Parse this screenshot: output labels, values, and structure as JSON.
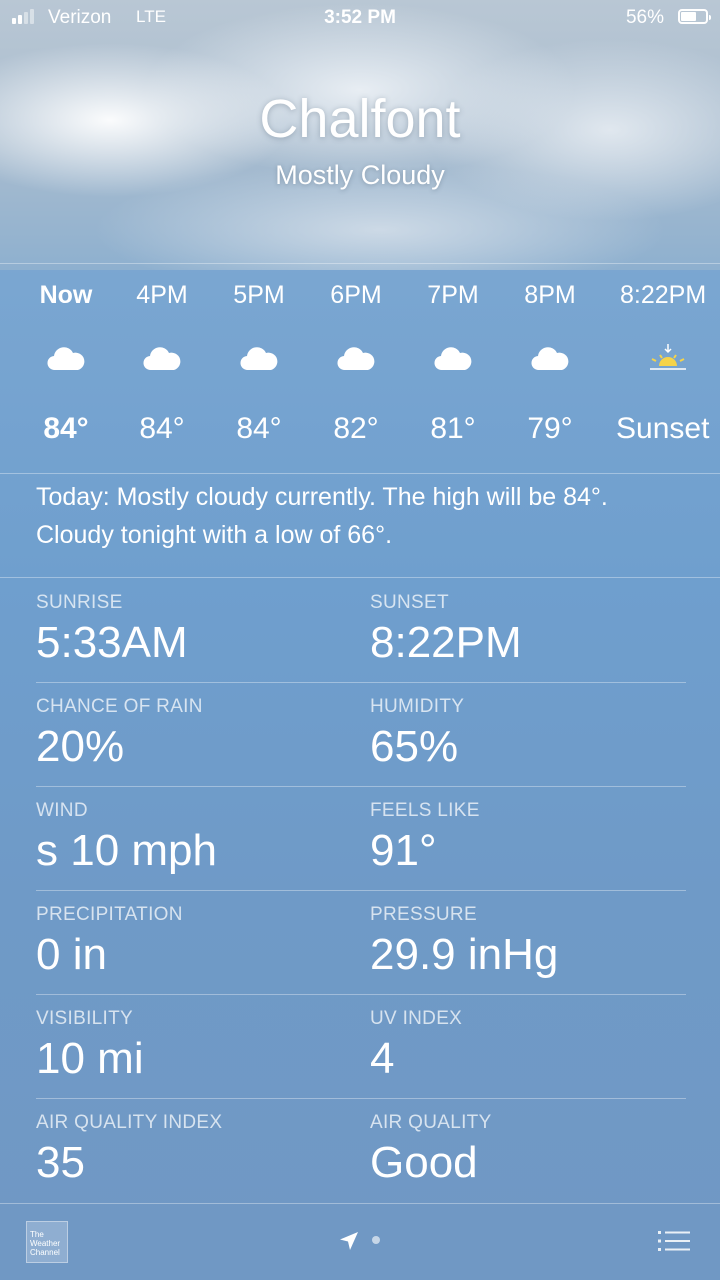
{
  "status_bar": {
    "carrier": "Verizon",
    "network": "LTE",
    "time": "3:52 PM",
    "battery": "56%"
  },
  "location": {
    "city": "Chalfont",
    "condition": "Mostly Cloudy"
  },
  "hourly": [
    {
      "time": "Now",
      "temp": "84°",
      "icon": "cloud-icon"
    },
    {
      "time": "4PM",
      "temp": "84°",
      "icon": "cloud-icon"
    },
    {
      "time": "5PM",
      "temp": "84°",
      "icon": "cloud-icon"
    },
    {
      "time": "6PM",
      "temp": "82°",
      "icon": "cloud-icon"
    },
    {
      "time": "7PM",
      "temp": "81°",
      "icon": "cloud-icon"
    },
    {
      "time": "8PM",
      "temp": "79°",
      "icon": "cloud-icon"
    },
    {
      "time": "8:22PM",
      "temp": "Sunset",
      "icon": "sunset-icon"
    }
  ],
  "summary": "Today: Mostly cloudy currently. The high will be 84°. Cloudy tonight with a low of 66°.",
  "details": [
    {
      "label": "SUNRISE",
      "value": "5:33AM"
    },
    {
      "label": "SUNSET",
      "value": "8:22PM"
    },
    {
      "label": "CHANCE OF RAIN",
      "value": "20%"
    },
    {
      "label": "HUMIDITY",
      "value": "65%"
    },
    {
      "label": "WIND",
      "value": "s 10 mph"
    },
    {
      "label": "FEELS LIKE",
      "value": "91°"
    },
    {
      "label": "PRECIPITATION",
      "value": "0 in"
    },
    {
      "label": "PRESSURE",
      "value": "29.9 inHg"
    },
    {
      "label": "VISIBILITY",
      "value": "10 mi"
    },
    {
      "label": "UV INDEX",
      "value": "4"
    },
    {
      "label": "AIR QUALITY INDEX",
      "value": "35"
    },
    {
      "label": "AIR QUALITY",
      "value": "Good"
    }
  ],
  "footer": {
    "logo_text": "The Weather Channel"
  },
  "colors": {
    "sunset_sun": "#f5d34a",
    "background": "#6f9ac7"
  }
}
